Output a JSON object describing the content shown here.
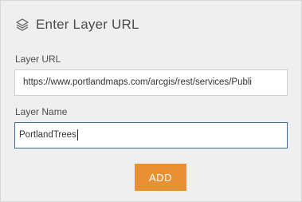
{
  "header": {
    "title": "Enter Layer URL",
    "icon": "layers-icon"
  },
  "form": {
    "url_label": "Layer URL",
    "url_value": "https://www.portlandmaps.com/arcgis/rest/services/Publi",
    "name_label": "Layer Name",
    "name_value": "PortlandTrees",
    "add_label": "ADD"
  },
  "colors": {
    "panel_bg": "#efefef",
    "accent": "#e89132",
    "focus_border": "#3f6f9f"
  }
}
